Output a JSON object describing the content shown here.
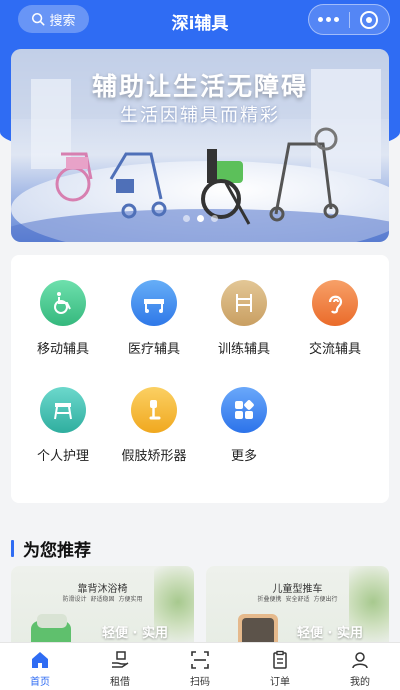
{
  "header": {
    "search_label": "搜索",
    "title": "深i辅具"
  },
  "banner": {
    "headline": "辅助让生活无障碍",
    "subline": "生活因辅具而精彩",
    "active_slide": 1,
    "slide_count": 3
  },
  "categories": [
    {
      "label": "移动辅具",
      "icon": "wheelchair-icon",
      "color": "#41c88b"
    },
    {
      "label": "医疗辅具",
      "icon": "hospital-bed-icon",
      "color": "#3d8ef0"
    },
    {
      "label": "训练辅具",
      "icon": "training-icon",
      "color": "#d3b078"
    },
    {
      "label": "交流辅具",
      "icon": "ear-icon",
      "color": "#f0843f"
    },
    {
      "label": "个人护理",
      "icon": "shower-chair-icon",
      "color": "#3bbfb2"
    },
    {
      "label": "假肢矫形器",
      "icon": "prosthetic-leg-icon",
      "color": "#f2b735"
    },
    {
      "label": "更多",
      "icon": "grid-more-icon",
      "color": "#3a83f2"
    }
  ],
  "recommend": {
    "title": "为您推荐",
    "items": [
      {
        "name": "靠背沐浴椅",
        "tags": [
          "防滑设计",
          "舒适稳固",
          "方便实用"
        ],
        "slogan": "轻便 · 实用"
      },
      {
        "name": "儿童型推车",
        "tags": [
          "折叠便携",
          "安全舒适",
          "方便出行"
        ],
        "slogan": "轻便 · 实用"
      }
    ]
  },
  "tabbar": {
    "items": [
      {
        "label": "首页",
        "icon": "home-icon"
      },
      {
        "label": "租借",
        "icon": "hand-package-icon"
      },
      {
        "label": "扫码",
        "icon": "scan-icon"
      },
      {
        "label": "订单",
        "icon": "order-icon"
      },
      {
        "label": "我的",
        "icon": "user-icon"
      }
    ],
    "active_index": 0
  },
  "colors": {
    "primary": "#2f6cf3",
    "background": "#f3f4f6"
  }
}
